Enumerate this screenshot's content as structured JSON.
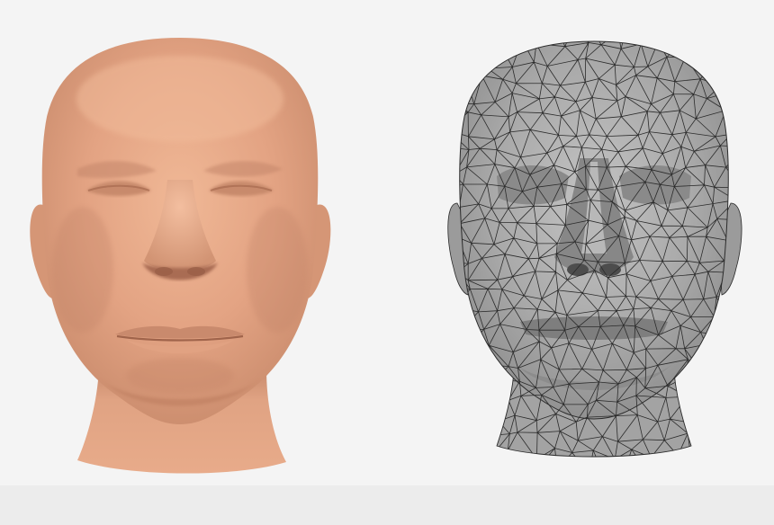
{
  "figure": {
    "panels": [
      {
        "id": "smooth",
        "style": "smooth shaded skin-tone face render"
      },
      {
        "id": "mesh",
        "style": "gray triangulated wireframe face mesh"
      }
    ]
  },
  "colors": {
    "background": "#f4f4f4",
    "skin_base": "#e0a07f",
    "skin_light": "#efb593",
    "skin_shadow": "#b9785a",
    "mesh_fill": "#a8a8a8",
    "mesh_light": "#c4c4c4",
    "mesh_dark": "#6f6f6f",
    "mesh_edge": "#2b2b2b"
  }
}
